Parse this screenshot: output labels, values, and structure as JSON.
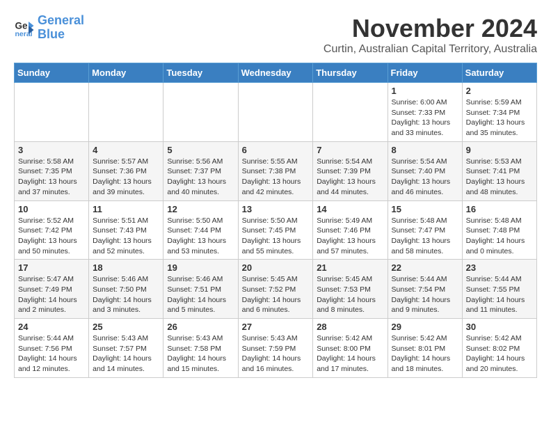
{
  "header": {
    "logo_line1": "General",
    "logo_line2": "Blue",
    "month": "November 2024",
    "location": "Curtin, Australian Capital Territory, Australia"
  },
  "weekdays": [
    "Sunday",
    "Monday",
    "Tuesday",
    "Wednesday",
    "Thursday",
    "Friday",
    "Saturday"
  ],
  "weeks": [
    [
      {
        "day": "",
        "info": ""
      },
      {
        "day": "",
        "info": ""
      },
      {
        "day": "",
        "info": ""
      },
      {
        "day": "",
        "info": ""
      },
      {
        "day": "",
        "info": ""
      },
      {
        "day": "1",
        "info": "Sunrise: 6:00 AM\nSunset: 7:33 PM\nDaylight: 13 hours\nand 33 minutes."
      },
      {
        "day": "2",
        "info": "Sunrise: 5:59 AM\nSunset: 7:34 PM\nDaylight: 13 hours\nand 35 minutes."
      }
    ],
    [
      {
        "day": "3",
        "info": "Sunrise: 5:58 AM\nSunset: 7:35 PM\nDaylight: 13 hours\nand 37 minutes."
      },
      {
        "day": "4",
        "info": "Sunrise: 5:57 AM\nSunset: 7:36 PM\nDaylight: 13 hours\nand 39 minutes."
      },
      {
        "day": "5",
        "info": "Sunrise: 5:56 AM\nSunset: 7:37 PM\nDaylight: 13 hours\nand 40 minutes."
      },
      {
        "day": "6",
        "info": "Sunrise: 5:55 AM\nSunset: 7:38 PM\nDaylight: 13 hours\nand 42 minutes."
      },
      {
        "day": "7",
        "info": "Sunrise: 5:54 AM\nSunset: 7:39 PM\nDaylight: 13 hours\nand 44 minutes."
      },
      {
        "day": "8",
        "info": "Sunrise: 5:54 AM\nSunset: 7:40 PM\nDaylight: 13 hours\nand 46 minutes."
      },
      {
        "day": "9",
        "info": "Sunrise: 5:53 AM\nSunset: 7:41 PM\nDaylight: 13 hours\nand 48 minutes."
      }
    ],
    [
      {
        "day": "10",
        "info": "Sunrise: 5:52 AM\nSunset: 7:42 PM\nDaylight: 13 hours\nand 50 minutes."
      },
      {
        "day": "11",
        "info": "Sunrise: 5:51 AM\nSunset: 7:43 PM\nDaylight: 13 hours\nand 52 minutes."
      },
      {
        "day": "12",
        "info": "Sunrise: 5:50 AM\nSunset: 7:44 PM\nDaylight: 13 hours\nand 53 minutes."
      },
      {
        "day": "13",
        "info": "Sunrise: 5:50 AM\nSunset: 7:45 PM\nDaylight: 13 hours\nand 55 minutes."
      },
      {
        "day": "14",
        "info": "Sunrise: 5:49 AM\nSunset: 7:46 PM\nDaylight: 13 hours\nand 57 minutes."
      },
      {
        "day": "15",
        "info": "Sunrise: 5:48 AM\nSunset: 7:47 PM\nDaylight: 13 hours\nand 58 minutes."
      },
      {
        "day": "16",
        "info": "Sunrise: 5:48 AM\nSunset: 7:48 PM\nDaylight: 14 hours\nand 0 minutes."
      }
    ],
    [
      {
        "day": "17",
        "info": "Sunrise: 5:47 AM\nSunset: 7:49 PM\nDaylight: 14 hours\nand 2 minutes."
      },
      {
        "day": "18",
        "info": "Sunrise: 5:46 AM\nSunset: 7:50 PM\nDaylight: 14 hours\nand 3 minutes."
      },
      {
        "day": "19",
        "info": "Sunrise: 5:46 AM\nSunset: 7:51 PM\nDaylight: 14 hours\nand 5 minutes."
      },
      {
        "day": "20",
        "info": "Sunrise: 5:45 AM\nSunset: 7:52 PM\nDaylight: 14 hours\nand 6 minutes."
      },
      {
        "day": "21",
        "info": "Sunrise: 5:45 AM\nSunset: 7:53 PM\nDaylight: 14 hours\nand 8 minutes."
      },
      {
        "day": "22",
        "info": "Sunrise: 5:44 AM\nSunset: 7:54 PM\nDaylight: 14 hours\nand 9 minutes."
      },
      {
        "day": "23",
        "info": "Sunrise: 5:44 AM\nSunset: 7:55 PM\nDaylight: 14 hours\nand 11 minutes."
      }
    ],
    [
      {
        "day": "24",
        "info": "Sunrise: 5:44 AM\nSunset: 7:56 PM\nDaylight: 14 hours\nand 12 minutes."
      },
      {
        "day": "25",
        "info": "Sunrise: 5:43 AM\nSunset: 7:57 PM\nDaylight: 14 hours\nand 14 minutes."
      },
      {
        "day": "26",
        "info": "Sunrise: 5:43 AM\nSunset: 7:58 PM\nDaylight: 14 hours\nand 15 minutes."
      },
      {
        "day": "27",
        "info": "Sunrise: 5:43 AM\nSunset: 7:59 PM\nDaylight: 14 hours\nand 16 minutes."
      },
      {
        "day": "28",
        "info": "Sunrise: 5:42 AM\nSunset: 8:00 PM\nDaylight: 14 hours\nand 17 minutes."
      },
      {
        "day": "29",
        "info": "Sunrise: 5:42 AM\nSunset: 8:01 PM\nDaylight: 14 hours\nand 18 minutes."
      },
      {
        "day": "30",
        "info": "Sunrise: 5:42 AM\nSunset: 8:02 PM\nDaylight: 14 hours\nand 20 minutes."
      }
    ]
  ]
}
